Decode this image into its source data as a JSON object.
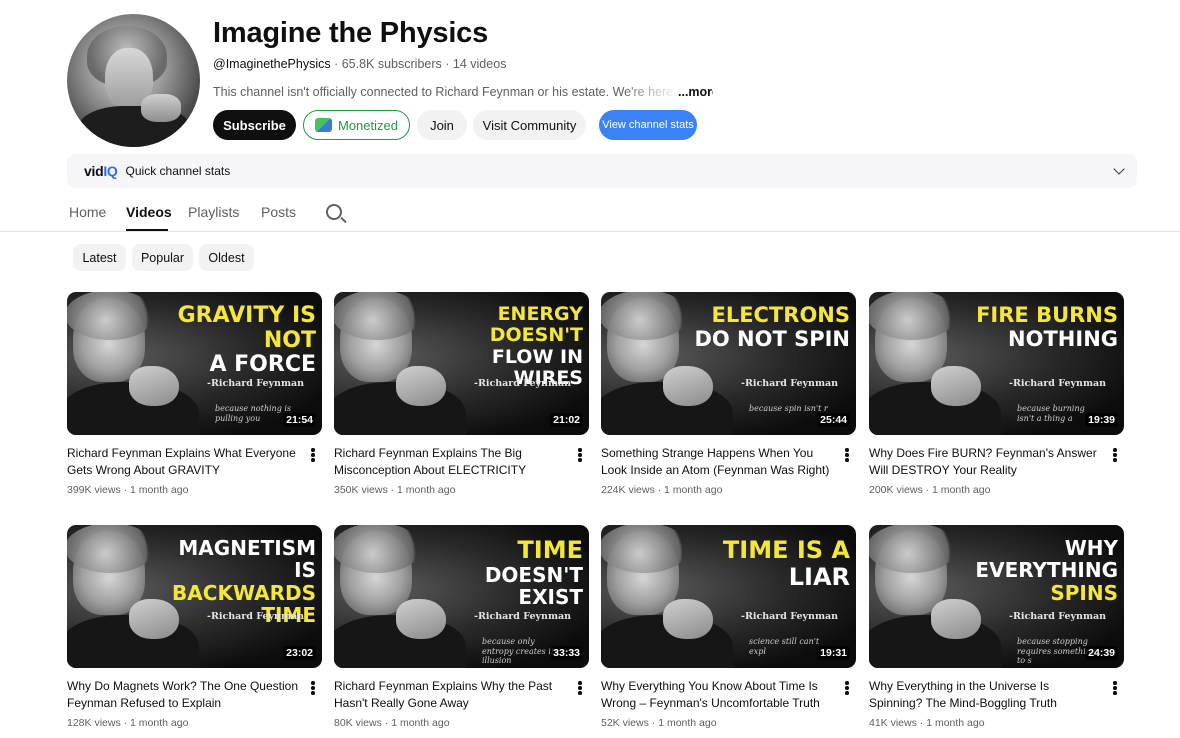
{
  "channel": {
    "title": "Imagine the Physics",
    "handle": "@ImaginethePhysics",
    "subscribers": "65.8K subscribers",
    "video_count": "14 videos",
    "description": "This channel isn't officially connected to Richard Feynman or his estate. We're here to sha",
    "more_label": "...more",
    "separator": " · "
  },
  "buttons": {
    "subscribe": "Subscribe",
    "monetized": "Monetized",
    "join": "Join",
    "community": "Visit Community",
    "channel_stats": "View channel stats"
  },
  "vidiq": {
    "logo_vid": "vid",
    "logo_iq": "IQ",
    "label": "Quick channel stats"
  },
  "tabs": [
    "Home",
    "Videos",
    "Playlists",
    "Posts"
  ],
  "filters": [
    "Latest",
    "Popular",
    "Oldest"
  ],
  "colors": {
    "headline_yellow": "#f5e63a",
    "headline_white": "#ffffff",
    "monetized_green": "#1b9e3e",
    "stats_blue": "#3b82f6"
  },
  "videos": [
    {
      "headline_line1": "GRAVITY IS NOT",
      "headline_line2": "A FORCE",
      "line1_color": "#f5e63a",
      "line2_color": "#ffffff",
      "signature": "-Richard Feynman",
      "cursive": "because nothing is pulling you",
      "duration": "21:54",
      "title": "Richard Feynman Explains What Everyone Gets Wrong About GRAVITY",
      "views": "399K views",
      "age": "1 month ago"
    },
    {
      "headline_line1": "ENERGY DOESN'T",
      "headline_line2": "FLOW IN WIRES",
      "line1_color": "#f5e63a",
      "line2_color": "#ffffff",
      "signature": "-Richard Feynman",
      "cursive": "",
      "duration": "21:02",
      "title": "Richard Feynman Explains The Big Misconception About ELECTRICITY",
      "views": "350K views",
      "age": "1 month ago"
    },
    {
      "headline_line1": "ELECTRONS",
      "headline_line2": "DO NOT SPIN",
      "line1_color": "#f5e63a",
      "line2_color": "#ffffff",
      "signature": "-Richard Feynman",
      "cursive": "because spin isn't r",
      "duration": "25:44",
      "title": "Something Strange Happens When You Look Inside an Atom (Feynman Was Right)",
      "views": "224K views",
      "age": "1 month ago"
    },
    {
      "headline_line1": "FIRE BURNS",
      "headline_line2": "NOTHING",
      "line1_color": "#f5e63a",
      "line2_color": "#ffffff",
      "signature": "-Richard Feynman",
      "cursive": "because burning isn't a thing a",
      "duration": "19:39",
      "title": "Why Does Fire BURN? Feynman's Answer Will DESTROY Your Reality",
      "views": "200K views",
      "age": "1 month ago"
    },
    {
      "headline_line1": "MAGNETISM IS",
      "headline_line2": "BACKWARDS TIME",
      "line1_color": "#ffffff",
      "line2_color": "#f5e63a",
      "signature": "-Richard Feynman",
      "cursive": "",
      "duration": "23:02",
      "title": "Why Do Magnets Work? The One Question Feynman Refused to Explain",
      "views": "128K views",
      "age": "1 month ago"
    },
    {
      "headline_line1": "TIME",
      "headline_line2": "DOESN'T EXIST",
      "line1_color": "#f5e63a",
      "line2_color": "#ffffff",
      "signature": "-Richard Feynman",
      "cursive": "because only entropy creates its illusion",
      "duration": "33:33",
      "title": "Richard Feynman Explains Why the Past Hasn't Really Gone Away",
      "views": "80K views",
      "age": "1 month ago"
    },
    {
      "headline_line1": "TIME IS A",
      "headline_line2": "LIAR",
      "line1_color": "#f5e63a",
      "line2_color": "#ffffff",
      "signature": "-Richard Feynman",
      "cursive": "science still can't expl",
      "duration": "19:31",
      "title": "Why Everything You Know About Time Is Wrong – Feynman's Uncomfortable Truth",
      "views": "52K views",
      "age": "1 month ago"
    },
    {
      "headline_line1": "WHY EVERYTHING",
      "headline_line2": "SPINS",
      "line1_color": "#ffffff",
      "line2_color": "#f5e63a",
      "signature": "-Richard Feynman",
      "cursive": "because stopping requires something to s",
      "duration": "24:39",
      "title": "Why Everything in the Universe Is Spinning? The Mind-Boggling Truth Feynman...",
      "views": "41K views",
      "age": "1 month ago"
    }
  ]
}
